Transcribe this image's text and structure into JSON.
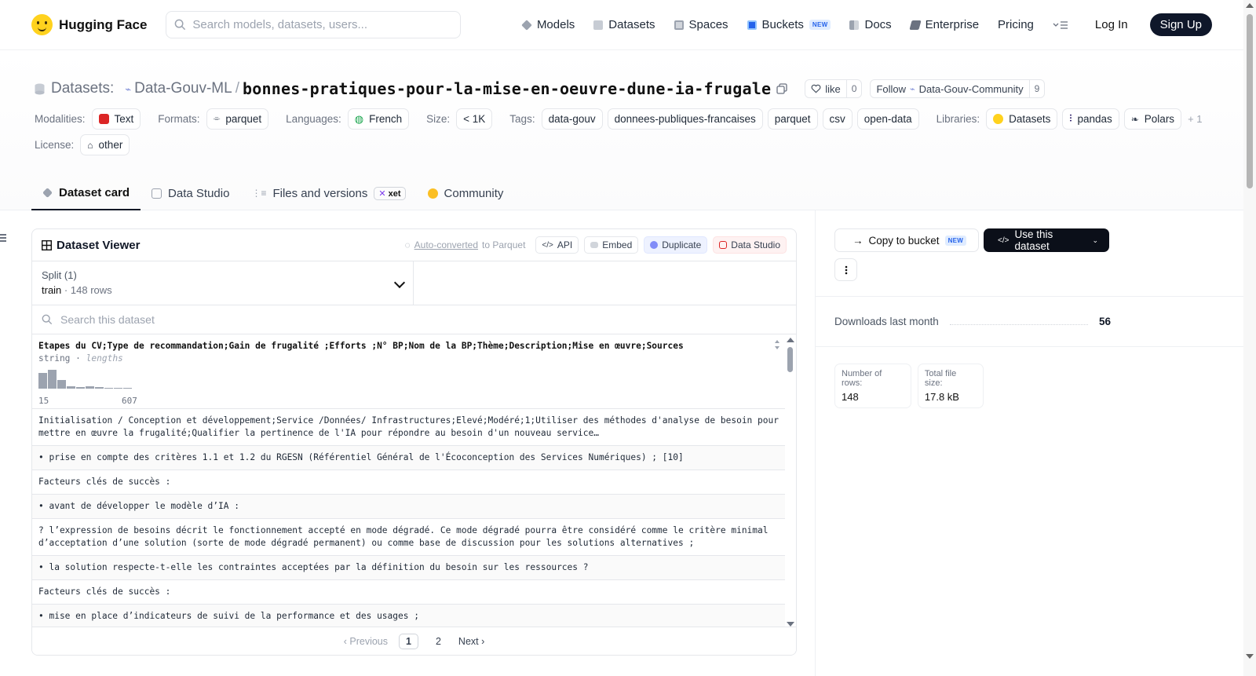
{
  "nav": {
    "brand": "Hugging Face",
    "search_placeholder": "Search models, datasets, users...",
    "links": [
      {
        "label": "Models",
        "icon": "cube-icon",
        "color": "#9ca3af"
      },
      {
        "label": "Datasets",
        "icon": "database-icon",
        "color": "#c7ccd4"
      },
      {
        "label": "Spaces",
        "icon": "grid-icon",
        "color": "#9ca3af"
      },
      {
        "label": "Buckets",
        "icon": "bucket-icon",
        "color": "#2563eb",
        "badge": "NEW"
      },
      {
        "label": "Docs",
        "icon": "book-icon",
        "color": "#9ca3af"
      },
      {
        "label": "Enterprise",
        "icon": "enterprise-icon",
        "color": "#6b7280"
      },
      {
        "label": "Pricing"
      }
    ],
    "login": "Log In",
    "signup": "Sign Up"
  },
  "header": {
    "datasets_label": "Datasets:",
    "org": "Data-Gouv-ML",
    "separator": "/",
    "name": "bonnes-pratiques-pour-la-mise-en-oeuvre-dune-ia-frugale",
    "like_label": "like",
    "like_count": "0",
    "follow_label": "Follow",
    "follow_org": "Data-Gouv-Community",
    "follow_count": "9"
  },
  "meta": {
    "modalities_label": "Modalities:",
    "modality": "Text",
    "formats_label": "Formats:",
    "format": "parquet",
    "languages_label": "Languages:",
    "language": "French",
    "size_label": "Size:",
    "size": "< 1K",
    "tags_label": "Tags:",
    "tags": [
      "data-gouv",
      "donnees-publiques-francaises",
      "parquet",
      "csv",
      "open-data"
    ],
    "libraries_label": "Libraries:",
    "libraries": [
      "Datasets",
      "pandas",
      "Polars"
    ],
    "more": "+ 1",
    "license_label": "License:",
    "license": "other"
  },
  "tabs": [
    {
      "label": "Dataset card",
      "active": true
    },
    {
      "label": "Data Studio"
    },
    {
      "label": "Files and versions",
      "badge": "xet"
    },
    {
      "label": "Community"
    }
  ],
  "viewer": {
    "title": "Dataset Viewer",
    "auto_link": "Auto-converted",
    "auto_rest": "to Parquet",
    "btn_api": "API",
    "btn_embed": "Embed",
    "btn_duplicate": "Duplicate",
    "btn_studio": "Data Studio",
    "split_label": "Split (1)",
    "split_name": "train",
    "split_dot": "·",
    "split_rows": "148 rows",
    "search_placeholder": "Search this dataset",
    "column": "Etapes du CV;Type de recommandation;Gain de frugalité ;Efforts ;N° BP;Nom de la BP;Thème;Description;Mise en œuvre;Sources",
    "column_type": "string",
    "column_sep": " · ",
    "column_stat": "lengths",
    "hist_values": [
      0.85,
      1.0,
      0.45,
      0.12,
      0.1,
      0.12,
      0.08,
      0.06,
      0.06,
      0.06
    ],
    "hist_min": "15",
    "hist_max": "607",
    "rows": [
      "Initialisation / Conception et développement;Service /Données/ Infrastructures;Elevé;Modéré;1;Utiliser des méthodes d'analyse de besoin pour mettre en œuvre la frugalité;Qualifier la pertinence de l'IA pour répondre au besoin d'un nouveau service…",
      "• prise en compte des critères 1.1 et 1.2 du RGESN (Référentiel Général de l'Écoconception des Services Numériques) ; [10]",
      "Facteurs clés de succès :",
      "• avant de développer le modèle d’IA :",
      "? l’expression de besoins décrit le fonctionnement accepté en mode dégradé. Ce mode dégradé pourra être considéré comme le critère minimal d’acceptation d’une solution (sorte de mode dégradé permanent) ou comme base de discussion pour les solutions alternatives ;",
      "• la solution respecte-t-elle les contraintes acceptées par la définition du besoin sur les ressources ?",
      "Facteurs clés de succès :",
      "• mise en place d’indicateurs de suivi de la performance et des usages ;"
    ],
    "pager_prev": "Previous",
    "pager_pages": [
      "1",
      "2"
    ],
    "pager_next": "Next"
  },
  "sidebar": {
    "copy_label": "Copy to bucket",
    "copy_badge": "NEW",
    "use_label": "Use this dataset",
    "downloads_label": "Downloads last month",
    "downloads_value": "56",
    "rows_label": "Number of rows:",
    "rows_value": "148",
    "size_label": "Total file size:",
    "size_value": "17.8 kB"
  }
}
